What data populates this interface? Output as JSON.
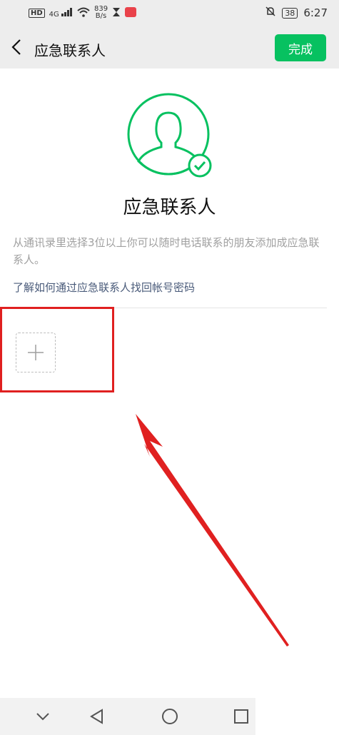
{
  "status_bar": {
    "network": "HD",
    "signal_label": "4G",
    "speed_value": "839",
    "speed_unit": "B/s",
    "battery": "38",
    "time": "6:27"
  },
  "header": {
    "title": "应急联系人",
    "done_label": "完成"
  },
  "main": {
    "heading": "应急联系人",
    "description": "从通讯录里选择3位以上你可以随时电话联系的朋友添加成应急联系人。",
    "help_link": "了解如何通过应急联系人找回帐号密码"
  },
  "colors": {
    "accent": "#07c160",
    "annotation": "#e02020",
    "link": "#4a5b7a"
  },
  "icons": {
    "back": "chevron-left-icon",
    "avatar": "user-check-icon",
    "add": "plus-icon",
    "nav_down": "chevron-down-icon",
    "nav_back": "triangle-back-icon",
    "nav_home": "circle-home-icon",
    "nav_recent": "square-recent-icon"
  }
}
